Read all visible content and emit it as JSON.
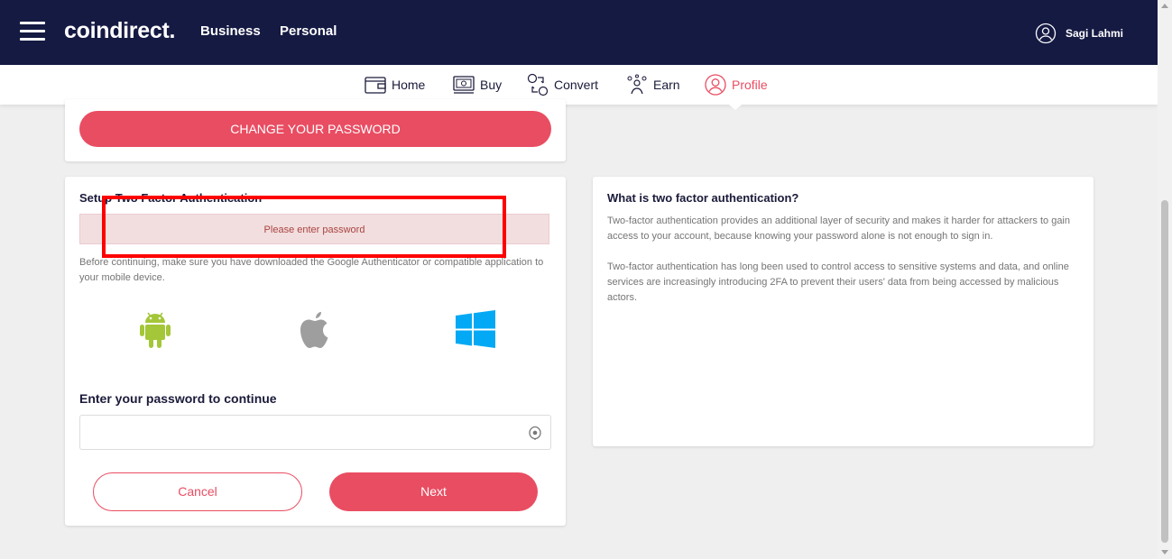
{
  "header": {
    "logo": "coindirect.",
    "links": [
      "Business",
      "Personal"
    ],
    "user_name": "Sagi Lahmi"
  },
  "nav": {
    "items": [
      {
        "label": "Home",
        "icon": "wallet-icon"
      },
      {
        "label": "Buy",
        "icon": "cash-icon"
      },
      {
        "label": "Convert",
        "icon": "convert-icon"
      },
      {
        "label": "Earn",
        "icon": "earn-icon"
      },
      {
        "label": "Profile",
        "icon": "profile-icon"
      }
    ],
    "active": "Profile"
  },
  "password_card": {
    "button_label": "CHANGE YOUR PASSWORD"
  },
  "twofa": {
    "title": "Setup Two Factor Authentication",
    "error": "Please enter password",
    "instructions": "Before continuing, make sure you have downloaded the Google Authenticator or compatible application to your mobile device.",
    "platforms": [
      "android-icon",
      "apple-icon",
      "windows-icon"
    ],
    "password_label": "Enter your password to continue",
    "password_value": "",
    "cancel_label": "Cancel",
    "next_label": "Next"
  },
  "info": {
    "title": "What is two factor authentication?",
    "para1": "Two-factor authentication provides an additional layer of security and makes it harder for attackers to gain access to your account, because knowing your password alone is not enough to sign in.",
    "para2": "Two-factor authentication has long been used to control access to sensitive systems and data, and online services are increasingly introducing 2FA to prevent their users' data from being accessed by malicious actors."
  },
  "colors": {
    "header_bg": "#151a43",
    "accent": "#e94d62",
    "error_bg": "#f2dede",
    "error_text": "#a94442",
    "annotation": "#ff0000"
  }
}
